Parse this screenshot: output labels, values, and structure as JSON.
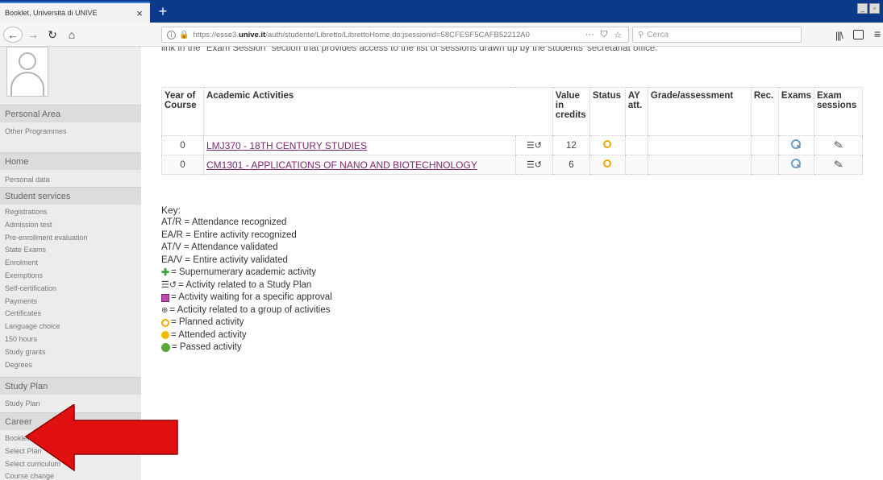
{
  "browser": {
    "tab_title": "Booklet, Università di UNIVE",
    "url_prefix": "https://esse3.",
    "url_domain": "unive.it",
    "url_rest": "/auth/studente/Libretto/LibrettoHome.do;jsessionid=58CFESF5CAFB52212A0",
    "search_placeholder": "Cerca"
  },
  "sidebar": {
    "personal_area": "Personal Area",
    "other_programmes": "Other Programmes",
    "home": "Home",
    "personal_data": "Personal data",
    "student_services": "Student services",
    "services": [
      "Registrations",
      "Admission test",
      "Pre-enrollment evaluation",
      "State Exams",
      "Enrolment",
      "Exemptions",
      "Self-certification",
      "Payments",
      "Certificates",
      "Language choice",
      "150 hours",
      "Study grants",
      "Degrees"
    ],
    "study_plan_header": "Study Plan",
    "study_plan_item": "Study Plan",
    "career_header": "Career",
    "career": [
      "Booklet",
      "Select Plan",
      "Select curriculum",
      "Course change"
    ]
  },
  "main": {
    "cut_text": "link in the \"Exam Session\" section that provides access to the list of sessions drawn up by the students' secretariat office.",
    "table": {
      "headers": {
        "year": "Year of Course",
        "activities": "Academic Activities",
        "value": "Value in credits",
        "status": "Status",
        "ay": "AY att.",
        "grade": "Grade/assessment",
        "rec": "Rec.",
        "exams": "Exams",
        "sessions": "Exam sessions"
      },
      "rows": [
        {
          "year": "0",
          "activity": "LMJ370 - 18TH CENTURY STUDIES",
          "credits": "12"
        },
        {
          "year": "0",
          "activity": "CM1301 - APPLICATIONS OF NANO AND BIOTECHNOLOGY",
          "credits": "6"
        }
      ]
    },
    "key": {
      "title": "Key:",
      "atr": "AT/R = Attendance recognized",
      "ear": "EA/R = Entire activity recognized",
      "atv": "AT/V = Attendance validated",
      "eav": "EA/V = Entire activity validated",
      "supernumerary": "= Supernumerary academic activity",
      "study_plan": "= Activity related to a Study Plan",
      "waiting": "= Activity waiting for a specific approval",
      "group": "= Acticity related to a group of activities",
      "planned": "= Planned activity",
      "attended": "= Attended activity",
      "passed": "= Passed activity"
    }
  },
  "colors": {
    "tabbar": "#0c3a8a",
    "link": "#7b2a6b",
    "arrow": "#e01010",
    "planned": "#f0a800",
    "passed": "#5aa73a"
  }
}
